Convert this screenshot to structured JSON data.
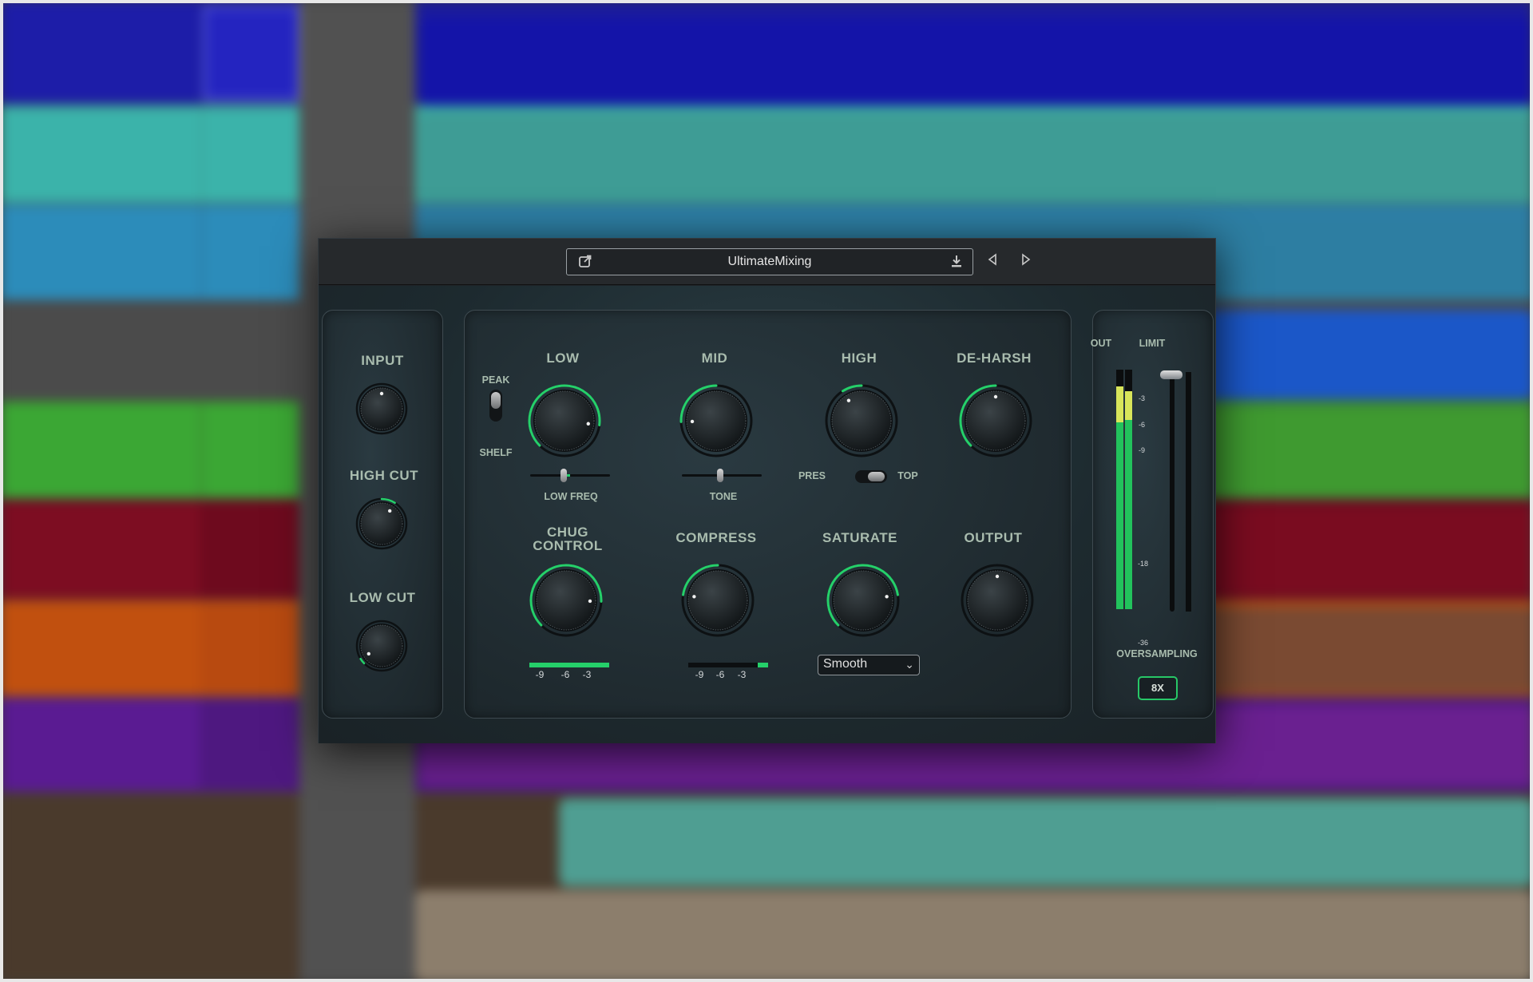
{
  "plugin": {
    "preset_name": "UltimateMixing",
    "input_label": "INPUT",
    "highcut_label": "HIGH CUT",
    "lowcut_label": "LOW CUT",
    "low_label": "LOW",
    "mid_label": "MID",
    "high_label": "HIGH",
    "deharsh_label": "DE-HARSH",
    "peak_label": "PEAK",
    "shelf_label": "SHELF",
    "lowfreq_label": "LOW FREQ",
    "tone_label": "TONE",
    "pres_label": "PRES",
    "top_label": "TOP",
    "chug_label_1": "CHUG",
    "chug_label_2": "CONTROL",
    "compress_label": "COMPRESS",
    "saturate_label": "SATURATE",
    "output_label": "OUTPUT",
    "out_label": "OUT",
    "limit_label": "LIMIT",
    "oversampling_label": "OVERSAMPLING",
    "oversampling_value": "8X",
    "saturate_mode": "Smooth",
    "gr_ticks": [
      "-9",
      "-6",
      "-3"
    ],
    "meter_ticks": [
      "-3",
      "-6",
      "-9",
      "-18",
      "-36"
    ],
    "accent_color": "#25d06a",
    "label_color": "#a9bcae",
    "knobs": {
      "input": 0.5,
      "high_cut": 0.62,
      "low_cut": 0.05,
      "low": 0.86,
      "mid": 0.16,
      "high": 0.38,
      "deharsh": 0.5,
      "chug": 0.84,
      "compress": 0.2,
      "saturate": 0.8,
      "output": 0.5
    },
    "low_freq_slider": 0.42,
    "tone_slider": 0.48,
    "chug_meter": 1.0,
    "compress_meter": 0.13,
    "meter_levels": {
      "left": 0.93,
      "right": 0.91,
      "left_peak": 0.15,
      "right_peak": 0.12
    },
    "limit_value": 1.0
  },
  "icons": {
    "open_window": "external-window-icon",
    "save": "download-icon",
    "prev": "triangle-left-icon",
    "next": "triangle-right-icon"
  }
}
